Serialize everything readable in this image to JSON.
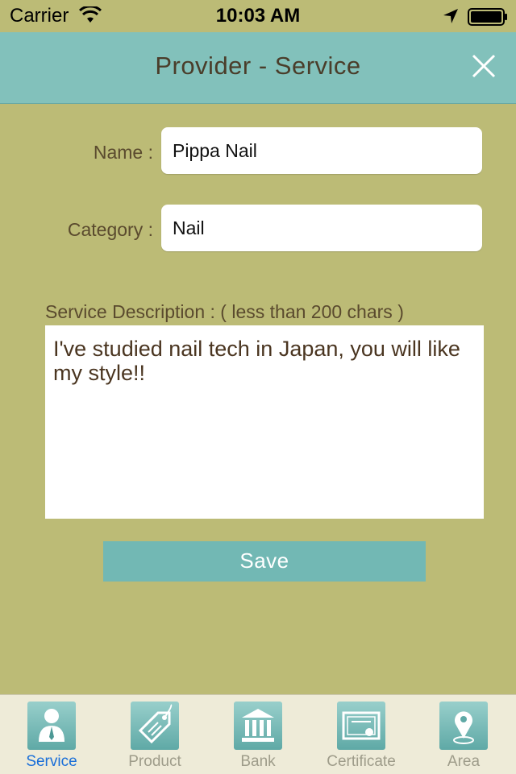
{
  "status_bar": {
    "carrier": "Carrier",
    "time": "10:03 AM"
  },
  "nav": {
    "title": "Provider - Service"
  },
  "form": {
    "name_label": "Name :",
    "name_value": "Pippa Nail",
    "category_label": "Category :",
    "category_value": "Nail",
    "description_label": "Service Description : ( less than 200 chars )",
    "description_value": "I've studied nail tech in Japan, you will like my style!!",
    "save_label": "Save"
  },
  "tabs": [
    {
      "label": "Service",
      "icon": "person-icon",
      "active": true
    },
    {
      "label": "Product",
      "icon": "tag-icon",
      "active": false
    },
    {
      "label": "Bank",
      "icon": "bank-icon",
      "active": false
    },
    {
      "label": "Certificate",
      "icon": "certificate-icon",
      "active": false
    },
    {
      "label": "Area",
      "icon": "map-pin-icon",
      "active": false
    }
  ],
  "colors": {
    "background": "#bcbb76",
    "nav_bar": "#82c1bb",
    "save_button": "#72b8b4",
    "tab_active": "#1a6fd8",
    "tab_inactive": "#9e9c8a"
  }
}
